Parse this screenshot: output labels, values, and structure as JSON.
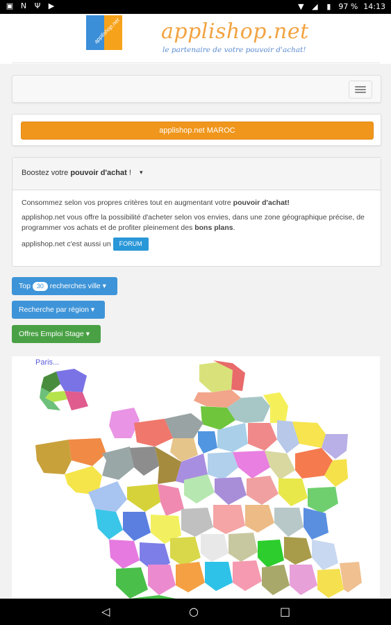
{
  "status_bar": {
    "battery": "97 %",
    "time": "14:13"
  },
  "header": {
    "brand": "applishop.net",
    "tagline": "le partenaire de votre pouvoir d'achat!",
    "logo_text": "applishop.net"
  },
  "maroc_button": "applishop.net MAROC",
  "panel": {
    "title_prefix": "Boostez votre ",
    "title_strong": "pouvoir d'achat",
    "title_suffix": " !",
    "p1_a": "Consommez selon vos propres critères tout en augmentant votre ",
    "p1_strong": "pouvoir d'achat!",
    "p2_a": "applishop.net vous offre la possibilité d'acheter selon vos envies, dans une zone géographique précise, de programmer vos achats et de profiter pleinement des ",
    "p2_strong": "bons plans",
    "p2_b": ".",
    "p3": "applishop.net c'est aussi un",
    "forum": "FORUM"
  },
  "buttons": {
    "top_prefix": "Top",
    "top_badge": "30",
    "top_suffix": "recherches ville",
    "region": "Recherche par région",
    "emploi": "Offres Emploi Stage"
  },
  "map": {
    "paris_label": "Paris..."
  },
  "colors": {
    "orange": "#f0961c",
    "blue": "#3e94d8",
    "green": "#4aa145"
  }
}
